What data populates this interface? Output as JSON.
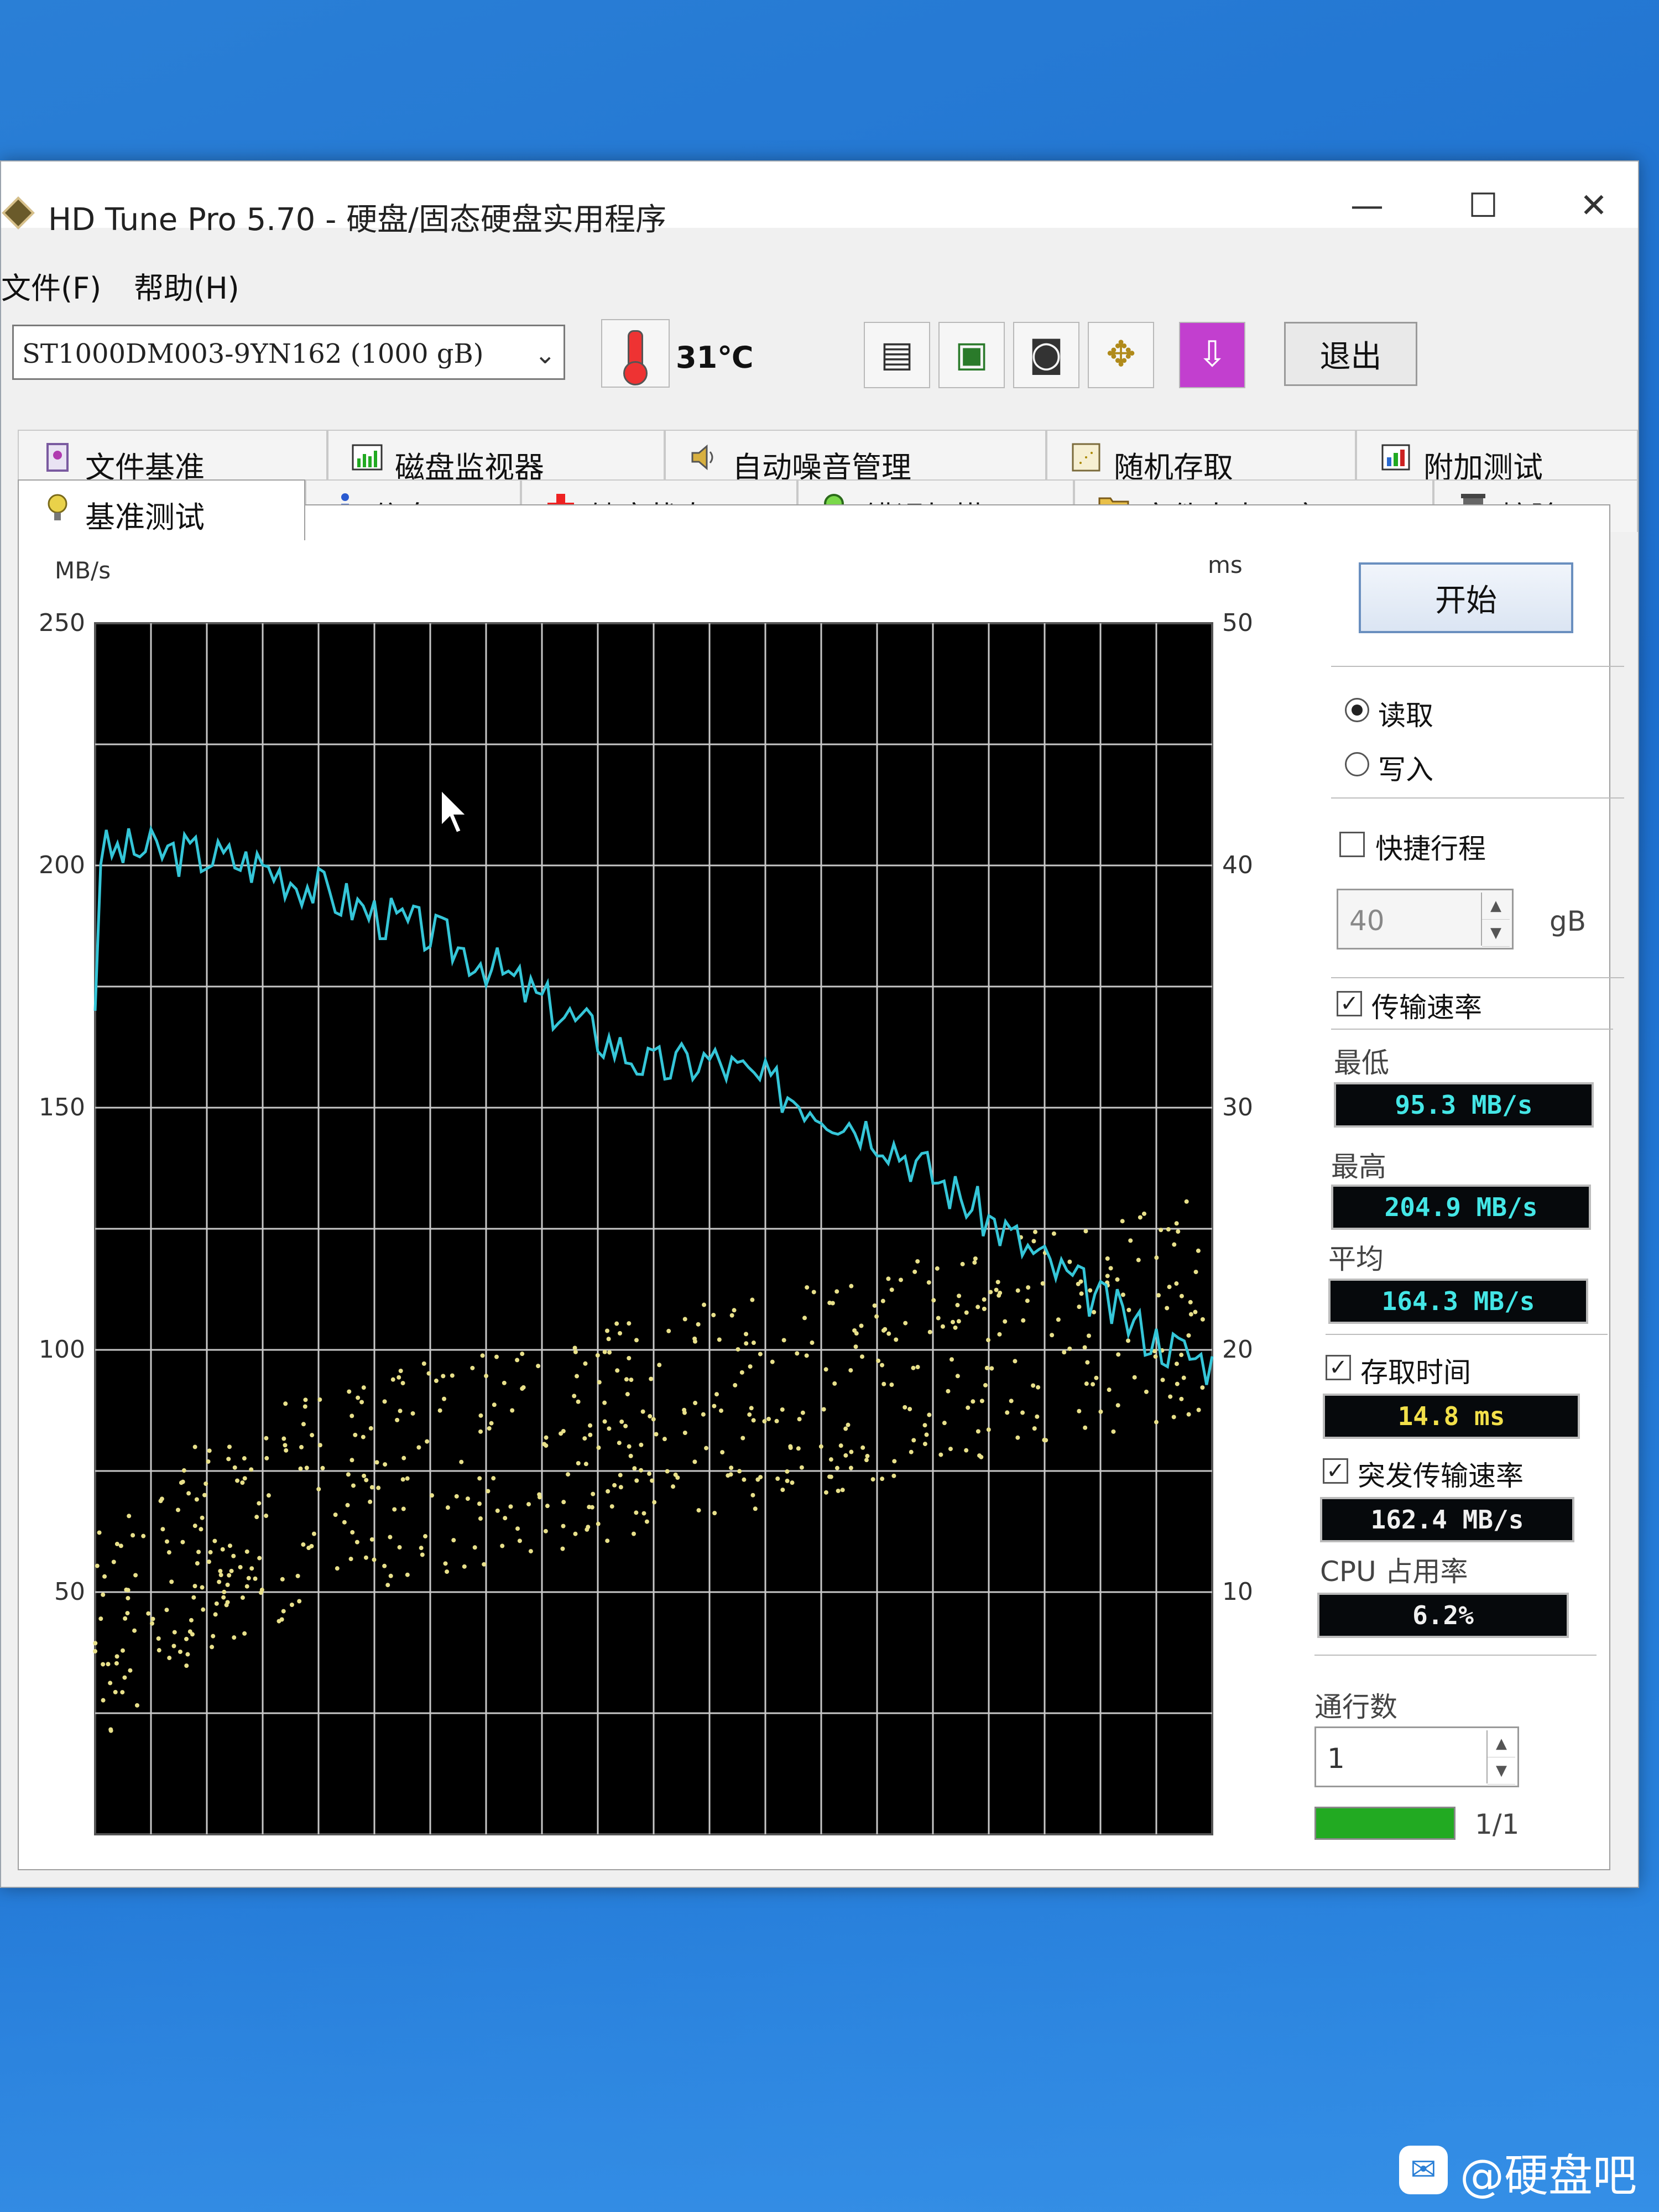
{
  "window": {
    "title": "HD Tune Pro 5.70 - 硬盘/固态硬盘实用程序",
    "controls": {
      "minimize": "—",
      "maximize": "☐",
      "close": "✕"
    }
  },
  "menu": {
    "file": "文件(F)",
    "help": "帮助(H)"
  },
  "toolbar": {
    "drive": "ST1000DM003-9YN162 (1000 gB)",
    "temperature": "31℃",
    "exit_label": "退出",
    "icons": [
      "copy-text-icon",
      "copy-screen-icon",
      "camera-icon",
      "options-icon",
      "save-down-icon"
    ]
  },
  "tabs_top": [
    {
      "label": "文件基准",
      "icon": "file-benchmark-icon"
    },
    {
      "label": "磁盘监视器",
      "icon": "disk-monitor-icon"
    },
    {
      "label": "自动噪音管理",
      "icon": "speaker-icon"
    },
    {
      "label": "随机存取",
      "icon": "random-access-icon"
    },
    {
      "label": "附加测试",
      "icon": "extra-tests-icon"
    }
  ],
  "tabs_bottom": [
    {
      "label": "基准测试",
      "icon": "benchmark-icon",
      "active": true
    },
    {
      "label": "信息",
      "icon": "info-icon"
    },
    {
      "label": "健康状态",
      "icon": "health-cross-icon"
    },
    {
      "label": "错误扫描",
      "icon": "magnifier-icon"
    },
    {
      "label": "文件夹占用率",
      "icon": "folder-icon"
    },
    {
      "label": "擦除",
      "icon": "trash-icon"
    }
  ],
  "side": {
    "start_label": "开始",
    "read_label": "读取",
    "write_label": "写入",
    "read_selected": true,
    "short_stroke_label": "快捷行程",
    "short_stroke_checked": false,
    "short_stroke_value": "40",
    "short_stroke_unit": "gB",
    "transfer_rate_label": "传输速率",
    "transfer_rate_checked": true,
    "min_label": "最低",
    "min_value": "95.3 MB/s",
    "max_label": "最高",
    "max_value": "204.9 MB/s",
    "avg_label": "平均",
    "avg_value": "164.3 MB/s",
    "access_time_label": "存取时间",
    "access_time_checked": true,
    "access_time_value": "14.8 ms",
    "burst_label": "突发传输速率",
    "burst_checked": true,
    "burst_value": "162.4 MB/s",
    "cpu_label": "CPU 占用率",
    "cpu_value": "6.2%",
    "passes_label": "通行数",
    "passes_value": "1",
    "progress_text": "1/1",
    "progress_fraction": 1.0,
    "progress_color": "#22aa22"
  },
  "chart_data": {
    "type": "line",
    "left_axis_unit": "MB/s",
    "right_axis_unit": "ms",
    "left_ylim": [
      0,
      250
    ],
    "right_ylim": [
      0,
      50
    ],
    "left_ticks": [
      250,
      200,
      150,
      100,
      50
    ],
    "right_ticks": [
      50,
      40,
      30,
      20,
      10
    ],
    "grid": true,
    "grid_columns": 20,
    "grid_rows": 10,
    "background": "#000000",
    "grid_color": "#c8c8c8",
    "series": [
      {
        "kind": "line",
        "axis": "left",
        "color": "#35c6d8",
        "x": [
          0,
          5,
          10,
          15,
          20,
          25,
          30,
          35,
          40,
          45,
          50,
          55,
          60,
          65,
          70,
          75,
          80,
          85,
          90,
          95,
          100
        ],
        "values": [
          203,
          203,
          202,
          200,
          195,
          190,
          186,
          180,
          172,
          165,
          158,
          160,
          155,
          150,
          145,
          136,
          127,
          118,
          110,
          102,
          97
        ]
      },
      {
        "kind": "scatter",
        "axis": "right",
        "color": "#e8e08a",
        "x": [
          0,
          10,
          20,
          30,
          40,
          50,
          60,
          70,
          80,
          90,
          100
        ],
        "values": [
          8,
          12,
          14,
          15,
          16,
          17,
          18,
          19,
          20,
          21,
          22
        ]
      }
    ]
  },
  "watermark": "@硬盘吧",
  "cursor": "arrow"
}
